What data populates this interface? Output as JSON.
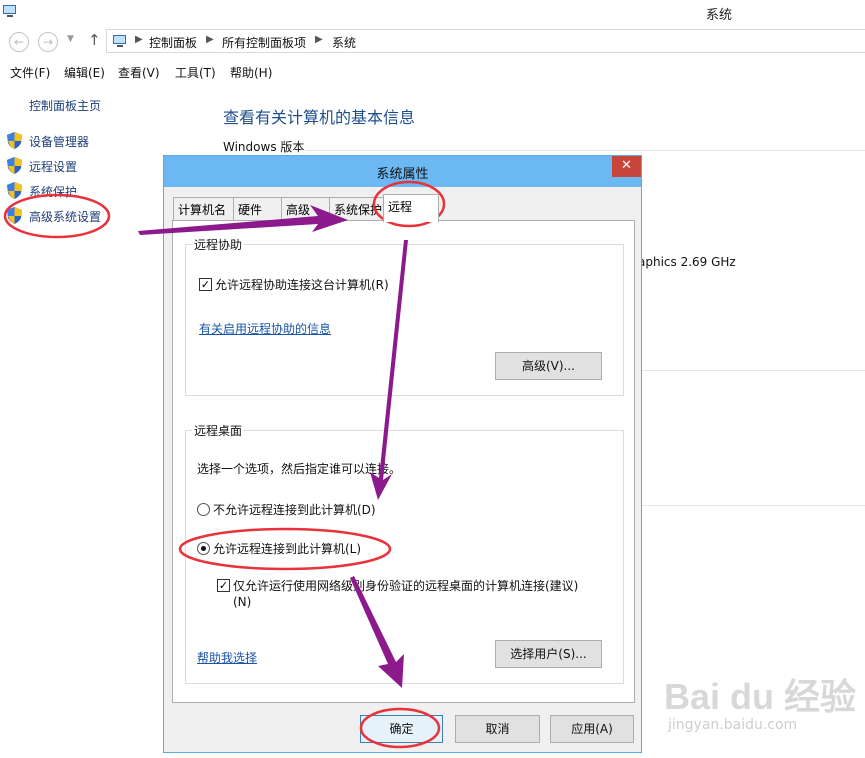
{
  "window": {
    "title": "系统"
  },
  "address_bar": {
    "crumbs": [
      "控制面板",
      "所有控制面板项",
      "系统"
    ]
  },
  "menu": [
    "文件(F)",
    "编辑(E)",
    "查看(V)",
    "工具(T)",
    "帮助(H)"
  ],
  "sidebar": {
    "home": "控制面板主页",
    "items": [
      {
        "label": "设备管理器",
        "icon": "shield-icon"
      },
      {
        "label": "远程设置",
        "icon": "shield-icon"
      },
      {
        "label": "系统保护",
        "icon": "shield-icon"
      },
      {
        "label": "高级系统设置",
        "icon": "shield-icon"
      }
    ]
  },
  "main": {
    "heading": "查看有关计算机的基本信息",
    "windows_version": "Windows 版本",
    "cpu_fragment": "aphics   2.69 GHz"
  },
  "dialog": {
    "title": "系统属性",
    "close": "✕",
    "tabs": [
      "计算机名",
      "硬件",
      "高级",
      "系统保护",
      "远程"
    ],
    "active_tab": "远程",
    "remote_assistance": {
      "group_title": "远程协助",
      "allow_label": "允许远程协助连接这台计算机(R)",
      "allow_checked": true,
      "info_link": "有关启用远程协助的信息",
      "advanced_button": "高级(V)..."
    },
    "remote_desktop": {
      "group_title": "远程桌面",
      "instruction": "选择一个选项，然后指定谁可以连接。",
      "option_deny": "不允许远程连接到此计算机(D)",
      "option_allow": "允许远程连接到此计算机(L)",
      "selected": "allow",
      "nla_label_line1": "仅允许运行使用网络级别身份验证的远程桌面的计算机连接(建议)",
      "nla_label_line2": "(N)",
      "nla_checked": true,
      "help_link": "帮助我选择",
      "select_users_button": "选择用户(S)..."
    },
    "buttons": {
      "ok": "确定",
      "cancel": "取消",
      "apply": "应用(A)"
    }
  },
  "watermark": {
    "brand": "Bai du 经验",
    "url": "jingyan.baidu.com"
  },
  "colors": {
    "annotation_red": "#e8323c",
    "annotation_arrow": "#8c1a8c",
    "dialog_title": "#6bb8f2",
    "link_blue": "#1a54a6"
  }
}
